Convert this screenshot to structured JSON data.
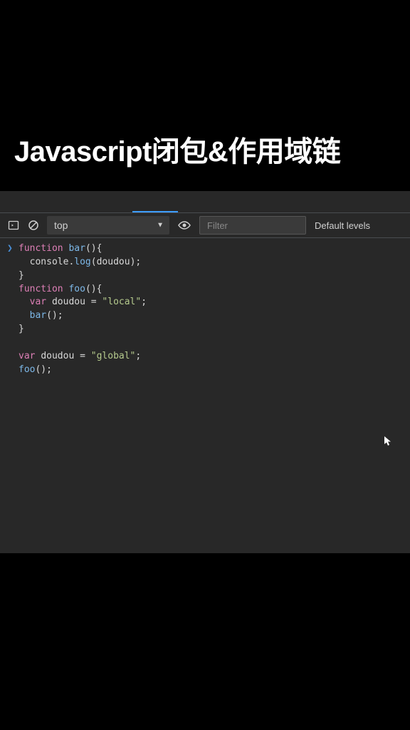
{
  "title": "Javascript闭包&作用域链",
  "toolbar": {
    "context": "top",
    "filter_placeholder": "Filter",
    "levels_label": "Default levels"
  },
  "code": {
    "tokens": [
      [
        [
          "kw",
          "function"
        ],
        [
          "pun",
          " "
        ],
        [
          "fn",
          "bar"
        ],
        [
          "pun",
          "(){"
        ]
      ],
      [
        [
          "pun",
          "  "
        ],
        [
          "obj",
          "console"
        ],
        [
          "pun",
          "."
        ],
        [
          "fn",
          "log"
        ],
        [
          "pun",
          "("
        ],
        [
          "id",
          "doudou"
        ],
        [
          "pun",
          ");"
        ]
      ],
      [
        [
          "pun",
          "}"
        ]
      ],
      [
        [
          "kw",
          "function"
        ],
        [
          "pun",
          " "
        ],
        [
          "fn",
          "foo"
        ],
        [
          "pun",
          "(){"
        ]
      ],
      [
        [
          "pun",
          "  "
        ],
        [
          "kw",
          "var"
        ],
        [
          "pun",
          " "
        ],
        [
          "id",
          "doudou"
        ],
        [
          "pun",
          " = "
        ],
        [
          "str",
          "\"local\""
        ],
        [
          "pun",
          ";"
        ]
      ],
      [
        [
          "pun",
          "  "
        ],
        [
          "fn",
          "bar"
        ],
        [
          "pun",
          "();"
        ]
      ],
      [
        [
          "pun",
          "}"
        ]
      ],
      [
        [
          "pun",
          ""
        ]
      ],
      [
        [
          "kw",
          "var"
        ],
        [
          "pun",
          " "
        ],
        [
          "id",
          "doudou"
        ],
        [
          "pun",
          " = "
        ],
        [
          "str",
          "\"global\""
        ],
        [
          "pun",
          ";"
        ]
      ],
      [
        [
          "fn",
          "foo"
        ],
        [
          "pun",
          "();"
        ]
      ]
    ]
  }
}
